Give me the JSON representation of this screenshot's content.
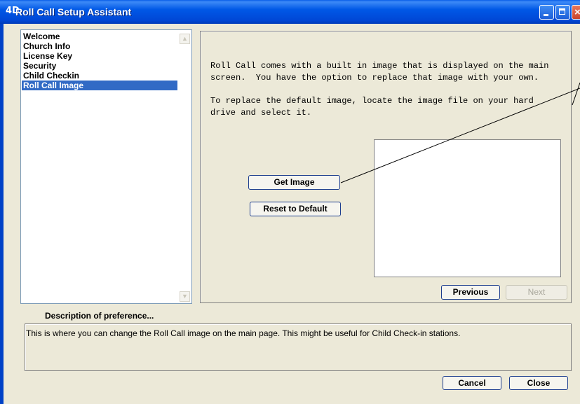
{
  "window": {
    "app_icon_text": "4D",
    "title": "Roll Call Setup Assistant"
  },
  "sidebar": {
    "items": [
      {
        "label": "Welcome",
        "selected": false
      },
      {
        "label": "Church Info",
        "selected": false
      },
      {
        "label": "License Key",
        "selected": false
      },
      {
        "label": "Security",
        "selected": false
      },
      {
        "label": "Child Checkin",
        "selected": false
      },
      {
        "label": "Roll Call Image",
        "selected": true
      }
    ]
  },
  "content": {
    "paragraph1": "Roll Call comes with a built in image that is displayed on the main\nscreen.  You have the option to replace that image with your own.",
    "paragraph2": "To replace the default image, locate the image file on your hard\ndrive and select it.",
    "get_image_label": "Get Image",
    "reset_label": "Reset to Default",
    "previous_label": "Previous",
    "next_label": "Next"
  },
  "description": {
    "label": "Description of preference...",
    "text": "This is where you can change the Roll Call image on the main page.  This might be useful for Child Check-in stations."
  },
  "footer": {
    "cancel_label": "Cancel",
    "close_label": "Close"
  },
  "colors": {
    "titlebar": "#0058e6",
    "selection": "#316ac5",
    "window_bg": "#ece9d8"
  }
}
